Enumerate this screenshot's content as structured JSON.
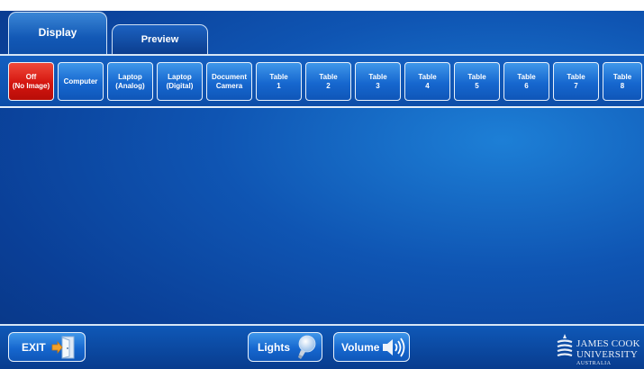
{
  "tabs": [
    {
      "label": "Display"
    },
    {
      "label": "Preview"
    }
  ],
  "sources": [
    {
      "label": "Off\n(No Image)",
      "state": "active"
    },
    {
      "label": "Computer"
    },
    {
      "label": "Laptop\n(Analog)"
    },
    {
      "label": "Laptop\n(Digital)"
    },
    {
      "label": "Document\nCamera"
    },
    {
      "label": "Table\n1"
    },
    {
      "label": "Table\n2"
    },
    {
      "label": "Table\n3"
    },
    {
      "label": "Table\n4"
    },
    {
      "label": "Table\n5"
    },
    {
      "label": "Table\n6"
    },
    {
      "label": "Table\n7"
    },
    {
      "label": "Table\n8"
    }
  ],
  "controls": {
    "exit_label": "EXIT",
    "lights_label": "Lights",
    "volume_label": "Volume"
  },
  "logo": {
    "line1": "JAMES COOK",
    "line2": "UNIVERSITY",
    "line3": "AUSTRALIA"
  },
  "colors": {
    "background": "#0f55b3",
    "active_source": "#d4150f",
    "button": "#1667cf"
  },
  "icons": [
    "exit-door-icon",
    "light-bulb-icon",
    "speaker-icon",
    "university-crest-icon"
  ]
}
